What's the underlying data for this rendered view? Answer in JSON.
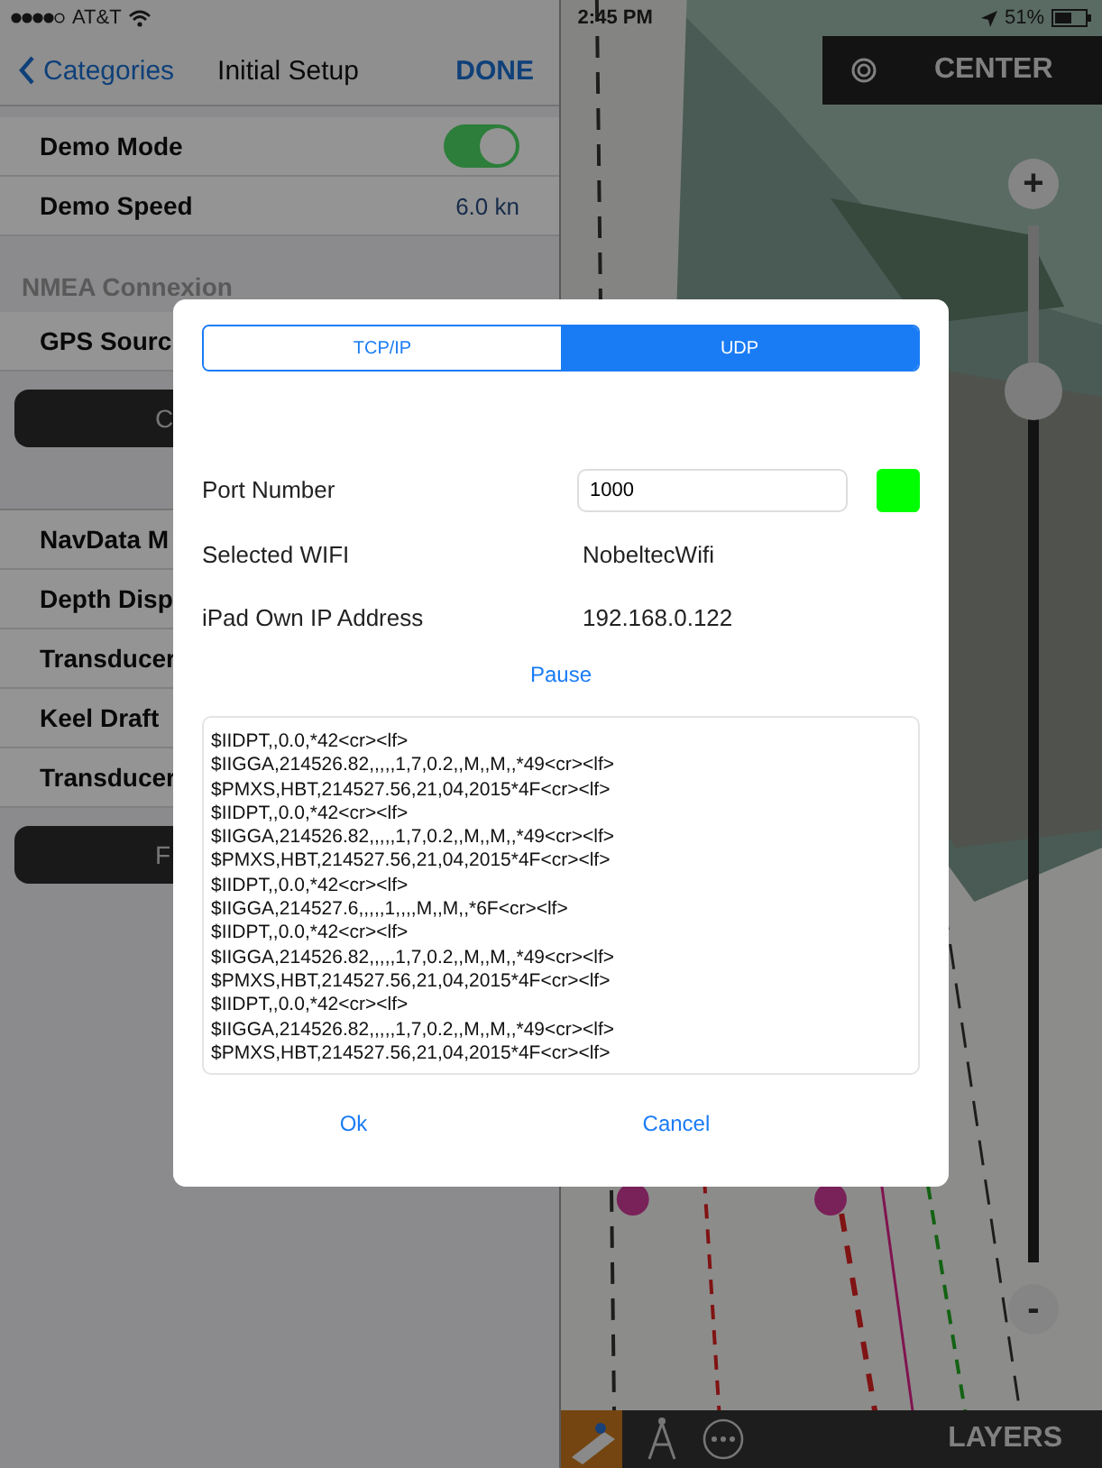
{
  "status_bar": {
    "carrier": "AT&T",
    "time": "2:45 PM",
    "battery": "51%"
  },
  "settings": {
    "back": "Categories",
    "title": "Initial Setup",
    "done": "DONE",
    "rows": [
      {
        "kind": "toggle",
        "label": "Demo Mode",
        "on": true
      },
      {
        "kind": "value",
        "label": "Demo Speed",
        "value": "6.0 kn"
      },
      {
        "kind": "header",
        "label": "NMEA Connexion"
      },
      {
        "kind": "value",
        "label": "GPS Sourc"
      },
      {
        "kind": "button",
        "label": "C"
      },
      {
        "kind": "gap"
      },
      {
        "kind": "value",
        "label": "NavData M"
      },
      {
        "kind": "value",
        "label": "Depth Disp"
      },
      {
        "kind": "value",
        "label": "Transducer"
      },
      {
        "kind": "value",
        "label": "Keel Draft"
      },
      {
        "kind": "value",
        "label": "Transducer"
      },
      {
        "kind": "button",
        "label": "F"
      }
    ]
  },
  "map": {
    "center": "CENTER",
    "zoom_in": "+",
    "zoom_out": "-",
    "zoom_level": {
      "level": 0.84
    },
    "toolbar": {
      "layers": "LAYERS"
    }
  },
  "dialog": {
    "tabs": [
      {
        "label": "TCP/IP",
        "selected": false
      },
      {
        "label": "UDP",
        "selected": true
      }
    ],
    "port": {
      "label": "Port Number",
      "value": "1000",
      "connected": true
    },
    "wifi": {
      "label": "Selected WIFI",
      "value": "NobeltecWifi"
    },
    "ip": {
      "label": "iPad Own IP Address",
      "value": "192.168.0.122"
    },
    "pause": "Pause",
    "log": [
      "$IIDPT,,0.0,*42<cr><lf>",
      "$IIGGA,214526.82,,,,,1,7,0.2,,M,,M,,*49<cr><lf>",
      "$PMXS,HBT,214527.56,21,04,2015*4F<cr><lf>",
      "$IIDPT,,0.0,*42<cr><lf>",
      "$IIGGA,214526.82,,,,,1,7,0.2,,M,,M,,*49<cr><lf>",
      "$PMXS,HBT,214527.56,21,04,2015*4F<cr><lf>",
      "$IIDPT,,0.0,*42<cr><lf>",
      "$IIGGA,214527.6,,,,,1,,,,M,,M,,*6F<cr><lf>",
      "$IIDPT,,0.0,*42<cr><lf>",
      "$IIGGA,214526.82,,,,,1,7,0.2,,M,,M,,*49<cr><lf>",
      "$PMXS,HBT,214527.56,21,04,2015*4F<cr><lf>",
      "$IIDPT,,0.0,*42<cr><lf>",
      "$IIGGA,214526.82,,,,,1,7,0.2,,M,,M,,*49<cr><lf>",
      "$PMXS,HBT,214527.56,21,04,2015*4F<cr><lf>"
    ],
    "ok": "Ok",
    "cancel": "Cancel"
  }
}
